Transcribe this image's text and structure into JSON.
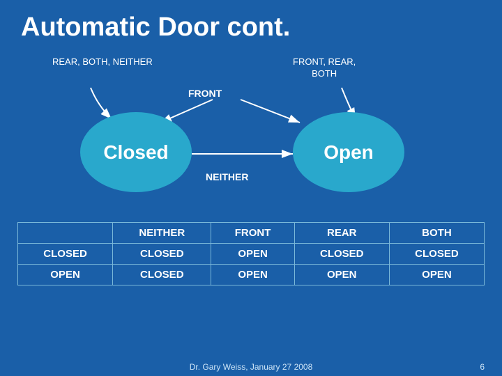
{
  "title": "Automatic Door cont.",
  "diagram": {
    "label_rear": "REAR, BOTH,\nNEITHER",
    "label_front_rear": "FRONT, REAR,\nBOTH",
    "label_front": "FRONT",
    "label_neither": "NEITHER",
    "circle_closed": "Closed",
    "circle_open": "Open"
  },
  "table": {
    "headers": [
      "",
      "NEITHER",
      "FRONT",
      "REAR",
      "BOTH"
    ],
    "rows": [
      [
        "CLOSED",
        "CLOSED",
        "OPEN",
        "CLOSED",
        "CLOSED"
      ],
      [
        "OPEN",
        "CLOSED",
        "OPEN",
        "OPEN",
        "OPEN"
      ]
    ]
  },
  "footer": {
    "citation": "Dr. Gary Weiss, January 27 2008",
    "page": "6"
  }
}
